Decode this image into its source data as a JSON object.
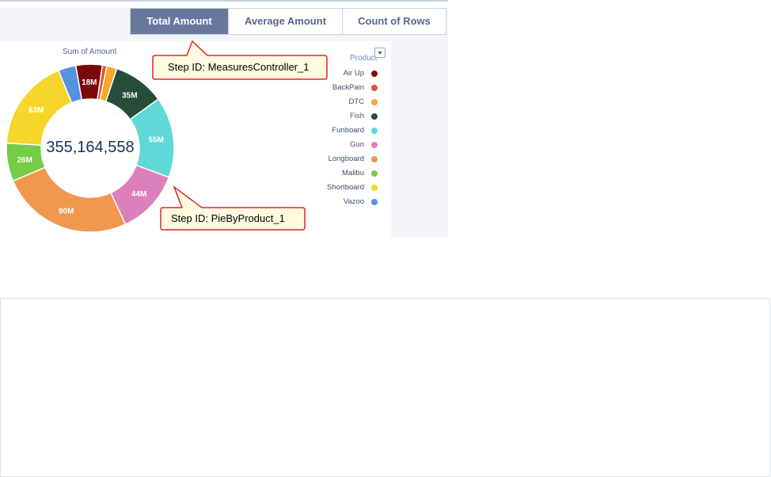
{
  "measures": {
    "buttons": [
      {
        "label": "Total Amount",
        "active": true
      },
      {
        "label": "Average Amount",
        "active": false
      },
      {
        "label": "Count of Rows",
        "active": false
      }
    ]
  },
  "chart_title": "Sum of Amount",
  "center_total": "355,164,558",
  "legend": {
    "title": "Product"
  },
  "callouts": {
    "measures": "Step ID: MeasuresController_1",
    "pie": "Step ID: PieByProduct_1"
  },
  "colors": {
    "callout_border": "#e0242b",
    "callout_fill": "#fffbe0",
    "active_toggle": "#67789c"
  },
  "chart_data": {
    "type": "pie",
    "title": "Sum of Amount",
    "center_label": "355,164,558",
    "series": [
      {
        "name": "Air Up",
        "value": 18,
        "label": "18M",
        "color": "#7a0a0a"
      },
      {
        "name": "BackPain",
        "value": 3,
        "label": "",
        "color": "#e0532f"
      },
      {
        "name": "DTC",
        "value": 7,
        "label": "",
        "color": "#f7a82a"
      },
      {
        "name": "Fish",
        "value": 35,
        "label": "35M",
        "color": "#254d37"
      },
      {
        "name": "Funboard",
        "value": 55,
        "label": "55M",
        "color": "#5fd8d8"
      },
      {
        "name": "Gun",
        "value": 44,
        "label": "44M",
        "color": "#dc80bb"
      },
      {
        "name": "Longboard",
        "value": 90,
        "label": "90M",
        "color": "#f2984e"
      },
      {
        "name": "Malibu",
        "value": 26,
        "label": "26M",
        "color": "#75cc46"
      },
      {
        "name": "Shortboard",
        "value": 63,
        "label": "63M",
        "color": "#f7d52a"
      },
      {
        "name": "Vazoo",
        "value": 12,
        "label": "",
        "color": "#5592e0"
      }
    ]
  }
}
